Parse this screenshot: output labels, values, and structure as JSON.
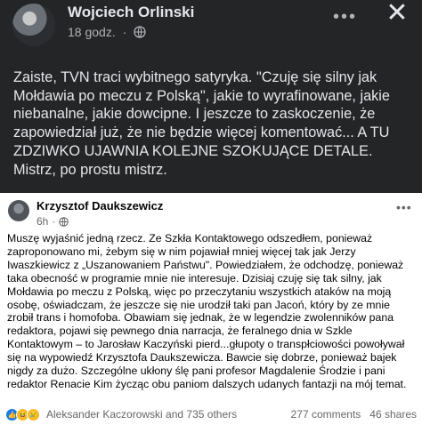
{
  "top_post": {
    "author": "Wojciech Orlinski",
    "time": "18 godz.",
    "audience_icon": "globe-icon",
    "text": "Zaiste, TVN traci wybitnego satyryka. \"Czuję się silny jak Mołdawia po meczu z Polską\", jakie to wyrafinowane, jakie niebanalne, jakie dowcipne. I jeszcze to zaskoczenie, że zapowiedział już, że nie będzie więcej komentować... A TU ZDZIWKO UJAWNIA KOLEJNE SZOKUJĄCE DETALE. Mistrz, po prostu mistrz."
  },
  "shared_post": {
    "author": "Krzysztof Daukszewicz",
    "time": "6h",
    "text": "Muszę wyjaśnić jedną rzecz. Ze Szkła Kontaktowego odszedłem, ponieważ zaproponowano mi, żebym się w nim pojawiał mniej więcej tak jak Jerzy Iwaszkiewicz z „Uszanowaniem Państwu\". Powiedziałem, że odchodzę, ponieważ taka obecność w programie mnie nie interesuje. Dzisiaj czuję się tak silny, jak Mołdawia po meczu z Polską, więc po przeczytaniu wszystkich ataków na moją osobę, oświadczam, że jeszcze się  nie urodził taki pan Jacoń, który by ze mnie zrobił trans i homofoba. Obawiam się jednak, że w legendzie zwolenników pana redaktora, pojawi się pewnego dnia narracja, że feralnego dnia w Szkle Kontaktowym – to Jarosław Kaczyński pierd...głupoty o transpłciowości powoływał się na wypowiedź Krzysztofa Daukszewicza. Bawcie się dobrze, ponieważ bajek nigdy za dużo. Szczególne ukłony ślę pani profesor Magdalenie Środzie i pani redaktor Renacie Kim życząc obu paniom dalszych udanych fantazji na mój temat.",
    "reactors": "Aleksander Kaczorowski and 735 others",
    "comments": "277 comments",
    "shares": "46 shares",
    "reactions": [
      "like",
      "haha",
      "sad"
    ]
  },
  "colors": {
    "dark_bg": "#242526",
    "dark_text": "#e4e6eb",
    "muted": "#b0b3b8",
    "light_bg": "#ffffff",
    "like_blue": "#1877f2",
    "emoji_yellow": "#f7b928"
  }
}
